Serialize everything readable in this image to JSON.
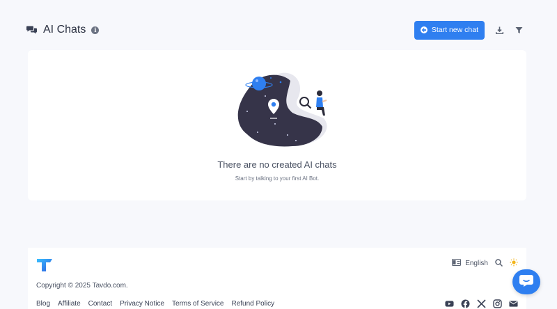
{
  "header": {
    "title": "AI Chats",
    "new_chat_label": "Start new chat"
  },
  "empty_state": {
    "title": "There are no created AI chats",
    "subtitle": "Start by talking to your first AI Bot."
  },
  "footer": {
    "language": "English",
    "copyright": "Copyright © 2025 Tavdo.com.",
    "links": [
      "Blog",
      "Affiliate",
      "Contact",
      "Privacy Notice",
      "Terms of Service",
      "Refund Policy"
    ],
    "social": [
      "youtube-icon",
      "facebook-icon",
      "x-icon",
      "instagram-icon",
      "mail-icon"
    ]
  },
  "colors": {
    "accent": "#2f7ff0",
    "background": "#f7f8fc",
    "illustration_dark": "#363449"
  }
}
